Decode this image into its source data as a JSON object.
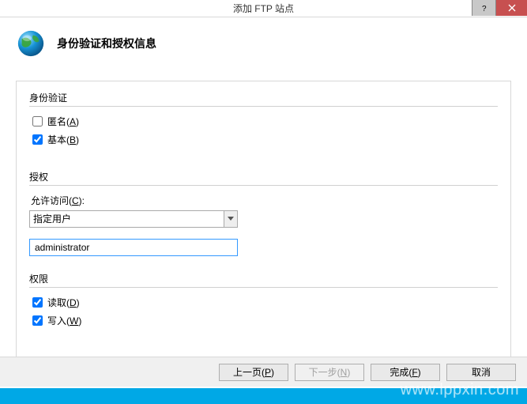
{
  "window": {
    "title": "添加 FTP 站点"
  },
  "header": {
    "title": "身份验证和授权信息"
  },
  "auth": {
    "section_label": "身份验证",
    "anonymous": {
      "label_pre": "匿名(",
      "hotkey": "A",
      "label_post": ")",
      "checked": false
    },
    "basic": {
      "label_pre": "基本(",
      "hotkey": "B",
      "label_post": ")",
      "checked": true
    }
  },
  "authorization": {
    "section_label": "授权",
    "allow_access_label_pre": "允许访问(",
    "allow_access_hotkey": "C",
    "allow_access_label_post": "):",
    "selected": "指定用户",
    "user_value": "administrator"
  },
  "permissions": {
    "section_label": "权限",
    "read": {
      "label_pre": "读取(",
      "hotkey": "D",
      "label_post": ")",
      "checked": true
    },
    "write": {
      "label_pre": "写入(",
      "hotkey": "W",
      "label_post": ")",
      "checked": true
    }
  },
  "buttons": {
    "prev_pre": "上一页(",
    "prev_hot": "P",
    "prev_post": ")",
    "next_pre": "下一步(",
    "next_hot": "N",
    "next_post": ")",
    "finish_pre": "完成(",
    "finish_hot": "F",
    "finish_post": ")",
    "cancel": "取消"
  },
  "watermark": "www.lppxin.com"
}
